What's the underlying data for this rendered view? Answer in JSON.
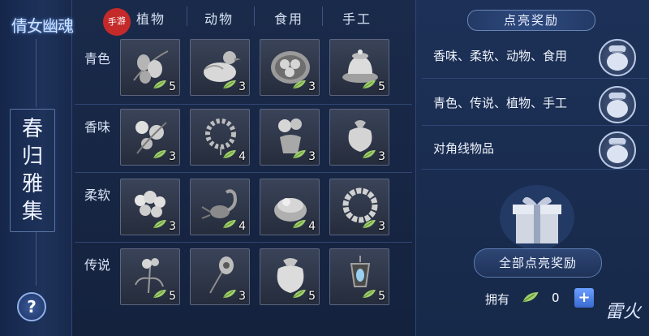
{
  "logo": {
    "text": "倩女幽魂",
    "seal": "手游"
  },
  "left": {
    "title_chars": [
      "春",
      "归",
      "雅",
      "集"
    ],
    "help_label": "?"
  },
  "columns": [
    "植物",
    "动物",
    "食用",
    "手工"
  ],
  "rows": [
    {
      "label": "青色",
      "cells": [
        {
          "icon": "olive-branch-icon",
          "count": "5"
        },
        {
          "icon": "duck-icon",
          "count": "3"
        },
        {
          "icon": "dumpling-plate-icon",
          "count": "3"
        },
        {
          "icon": "teapot-icon",
          "count": "5"
        }
      ]
    },
    {
      "label": "香味",
      "cells": [
        {
          "icon": "blossom-icon",
          "count": "3"
        },
        {
          "icon": "prayer-beads-icon",
          "count": "4"
        },
        {
          "icon": "flower-vase-icon",
          "count": "3"
        },
        {
          "icon": "sachet-icon",
          "count": "3"
        }
      ]
    },
    {
      "label": "柔软",
      "cells": [
        {
          "icon": "flower-cluster-icon",
          "count": "3"
        },
        {
          "icon": "scorpion-icon",
          "count": "4"
        },
        {
          "icon": "pastry-bowl-icon",
          "count": "4"
        },
        {
          "icon": "flower-wreath-icon",
          "count": "3"
        }
      ]
    },
    {
      "label": "传说",
      "cells": [
        {
          "icon": "herb-icon",
          "count": "5"
        },
        {
          "icon": "peacock-feather-icon",
          "count": "3"
        },
        {
          "icon": "cloth-pouch-icon",
          "count": "5"
        },
        {
          "icon": "lantern-icon",
          "count": "5"
        }
      ]
    }
  ],
  "rewards": {
    "header": "点亮奖励",
    "items": [
      {
        "text": "香味、柔软、动物、食用",
        "icon": "reward-bag-icon"
      },
      {
        "text": "青色、传说、植物、手工",
        "icon": "reward-bag-icon"
      },
      {
        "text": "对角线物品",
        "icon": "reward-bag-icon"
      }
    ],
    "all_button": "全部点亮奖励",
    "own_label": "拥有",
    "own_count": "0",
    "plus_label": "+"
  },
  "brand_mark": "雷火",
  "colors": {
    "cell_bg": "#2f3748",
    "panel_bg": "#1d3158",
    "accent": "#4a7ee0"
  }
}
